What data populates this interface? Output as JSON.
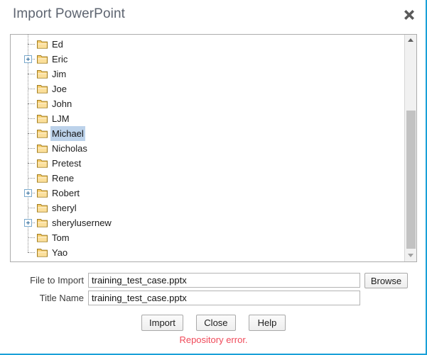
{
  "dialog": {
    "title": "Import PowerPoint",
    "close_icon": "close-icon"
  },
  "tree": {
    "items": [
      {
        "label": "Ed",
        "expandable": false,
        "selected": false
      },
      {
        "label": "Eric",
        "expandable": true,
        "selected": false
      },
      {
        "label": "Jim",
        "expandable": false,
        "selected": false
      },
      {
        "label": "Joe",
        "expandable": false,
        "selected": false
      },
      {
        "label": "John",
        "expandable": false,
        "selected": false
      },
      {
        "label": "LJM",
        "expandable": false,
        "selected": false
      },
      {
        "label": "Michael",
        "expandable": false,
        "selected": true
      },
      {
        "label": "Nicholas",
        "expandable": false,
        "selected": false
      },
      {
        "label": "Pretest",
        "expandable": false,
        "selected": false
      },
      {
        "label": "Rene",
        "expandable": false,
        "selected": false
      },
      {
        "label": "Robert",
        "expandable": true,
        "selected": false
      },
      {
        "label": "sheryl",
        "expandable": false,
        "selected": false
      },
      {
        "label": "sherylusernew",
        "expandable": true,
        "selected": false
      },
      {
        "label": "Tom",
        "expandable": false,
        "selected": false
      },
      {
        "label": "Yao",
        "expandable": false,
        "selected": false
      }
    ],
    "scrollbar": {
      "up_icon": "scroll-up-arrow-icon",
      "down_icon": "scroll-down-arrow-icon"
    }
  },
  "form": {
    "file_label": "File to Import",
    "file_value": "training_test_case.pptx",
    "title_label": "Title Name",
    "title_value": "training_test_case.pptx",
    "browse_label": "Browse"
  },
  "buttons": {
    "import_label": "Import",
    "close_label": "Close",
    "help_label": "Help"
  },
  "status": {
    "error_message": "Repository error."
  },
  "colors": {
    "border_accent": "#19a0d8",
    "selection": "#bcd2ea",
    "error": "#f04a5a",
    "folder": "#f6c04a"
  }
}
